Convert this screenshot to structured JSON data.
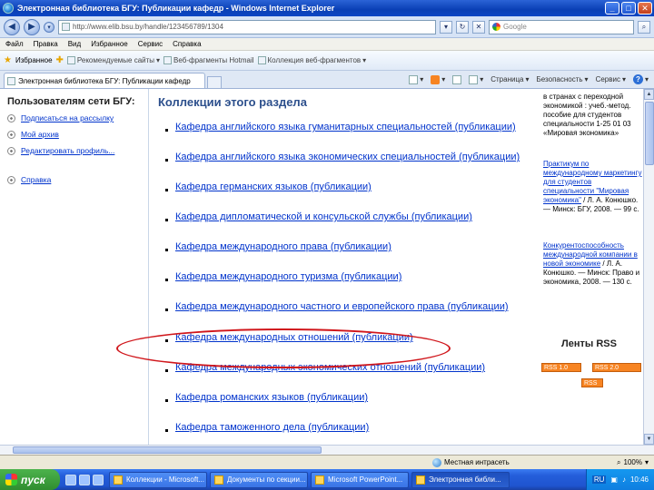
{
  "window": {
    "title": "Электронная библиотека БГУ: Публикации кафедр - Windows Internet Explorer",
    "buttons": {
      "minimize": "_",
      "maximize": "□",
      "close": "✕"
    }
  },
  "address_bar": {
    "url": "http://www.elib.bsu.by/handle/123456789/1304",
    "search_placeholder": "Google"
  },
  "menu": [
    "Файл",
    "Правка",
    "Вид",
    "Избранное",
    "Сервис",
    "Справка"
  ],
  "favorites_bar": {
    "label": "Избранное",
    "links": [
      "Рекомендуемые сайты",
      "Веб-фрагменты Hotmail",
      "Коллекция веб-фрагментов"
    ]
  },
  "tab": {
    "title": "Электронная библиотека БГУ: Публикации кафедр"
  },
  "command_bar": {
    "page": "Страница",
    "safety": "Безопасность",
    "tools": "Сервис",
    "help": "?"
  },
  "sidebar": {
    "heading": "Пользователям сети БГУ:",
    "items": [
      "Подписаться на рассылку",
      "Мой архив",
      "Редактировать профиль...",
      "Справка"
    ]
  },
  "main": {
    "section_title": "Коллекции этого раздела",
    "collections": [
      "Кафедра английского языка гуманитарных специальностей (публикации)",
      "Кафедра английского языка экономических специальностей (публикации)",
      "Кафедра германских языков (публикации)",
      "Кафедра дипломатической и консульской службы (публикации)",
      "Кафедра международного права (публикации)",
      "Кафедра международного туризма (публикации)",
      "Кафедра международного частного и европейского права (публикации)",
      "Кафедра международных отношений (публикации)",
      "Кафедра международных экономических отношений (публикации)",
      "Кафедра романских языков (публикации)",
      "Кафедра таможенного дела (публикации)"
    ]
  },
  "right_column": {
    "block1_plain": "в странах с переходной экономикой : учеб.-метод. пособие для студентов специальности 1-25 01 03 «Мировая экономика»",
    "block2_link": "Практикум по международному маркетингу для студентов специальности \"Мировая экономика\"",
    "block2_plain": " / Л. А. Конюшко. — Минск: БГУ, 2008. — 99 с.",
    "block3_link": "Конкурентоспособность международной компании в новой экономике",
    "block3_plain": " / Л. А. Конюшко. — Минск: Право и экономика, 2008. — 130 с.",
    "rss_title": "Ленты RSS",
    "rss_badges": [
      "RSS 1.0",
      "RSS 2.0",
      "RSS"
    ]
  },
  "status_bar": {
    "zone": "Местная интрасеть",
    "zoom": "100%"
  },
  "taskbar": {
    "start": "пуск",
    "tasks": [
      "Коллекции - Microsoft...",
      "Документы по секции...",
      "Microsoft PowerPoint...",
      "Электронная библи..."
    ],
    "lang": "RU",
    "time": "10:46"
  },
  "colors": {
    "link": "#0033cc",
    "section_title": "#2c4f8c",
    "highlight": "#d0161b",
    "rss": "#f78422"
  }
}
